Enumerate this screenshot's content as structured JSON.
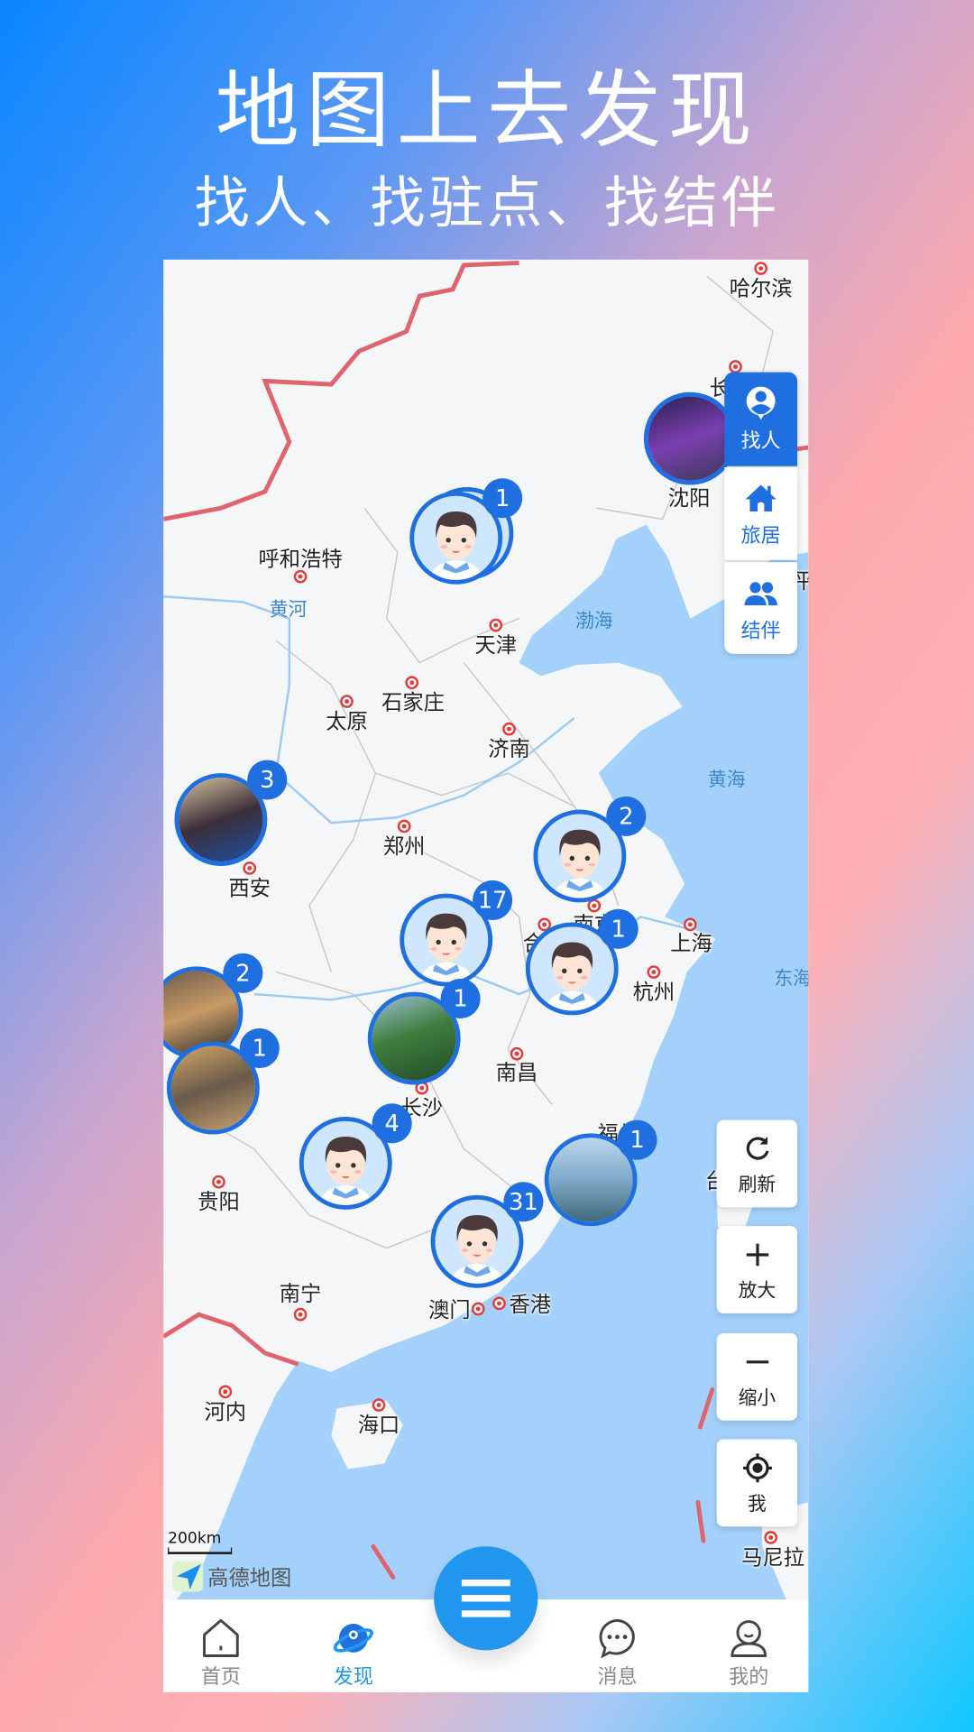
{
  "headline": {
    "title": "地图上去发现",
    "subtitle": "找人、找驻点、找结伴"
  },
  "colors": {
    "accent": "#1f6fe0",
    "sea": "#a3d1fb",
    "land": "#f5f6f8",
    "border": "#e06470",
    "nav_active": "#2196ee"
  },
  "map": {
    "provider": "高德地图",
    "scale_label": "200km",
    "cities": [
      "哈尔滨",
      "长",
      "沈阳",
      "呼和浩特",
      "天津",
      "石家庄",
      "太原",
      "济南",
      "郑州",
      "西安",
      "南京",
      "合",
      "上海",
      "杭州",
      "南昌",
      "长沙",
      "福州",
      "台",
      "贵阳",
      "南宁",
      "澳门",
      "香港",
      "河内",
      "海口",
      "马尼拉",
      "平"
    ],
    "water_labels": [
      "黄河",
      "渤海",
      "黄海",
      "东海"
    ],
    "markers": [
      {
        "type": "avatar",
        "count": "1"
      },
      {
        "type": "photo",
        "count": ""
      },
      {
        "type": "photo",
        "count": "3"
      },
      {
        "type": "avatar",
        "count": "2"
      },
      {
        "type": "avatar",
        "count": "17"
      },
      {
        "type": "avatar",
        "count": "1"
      },
      {
        "type": "photo",
        "count": "2"
      },
      {
        "type": "photo",
        "count": "1"
      },
      {
        "type": "photo",
        "count": "1"
      },
      {
        "type": "avatar",
        "count": "4"
      },
      {
        "type": "photo",
        "count": "1"
      },
      {
        "type": "avatar",
        "count": "31"
      }
    ]
  },
  "filter_panel": {
    "items": [
      {
        "label": "找人",
        "icon": "person-pin-icon",
        "active": true
      },
      {
        "label": "旅居",
        "icon": "home-icon",
        "active": false
      },
      {
        "label": "结伴",
        "icon": "group-icon",
        "active": false
      }
    ]
  },
  "map_controls": {
    "refresh": "刷新",
    "zoom_in": "放大",
    "zoom_out": "缩小",
    "locate": "我"
  },
  "bottom_nav": {
    "items": [
      {
        "label": "首页",
        "icon": "home-icon"
      },
      {
        "label": "发现",
        "icon": "planet-icon",
        "active": true
      },
      {
        "label": "消息",
        "icon": "chat-icon"
      },
      {
        "label": "我的",
        "icon": "user-icon"
      }
    ],
    "center_button": "menu-icon"
  }
}
